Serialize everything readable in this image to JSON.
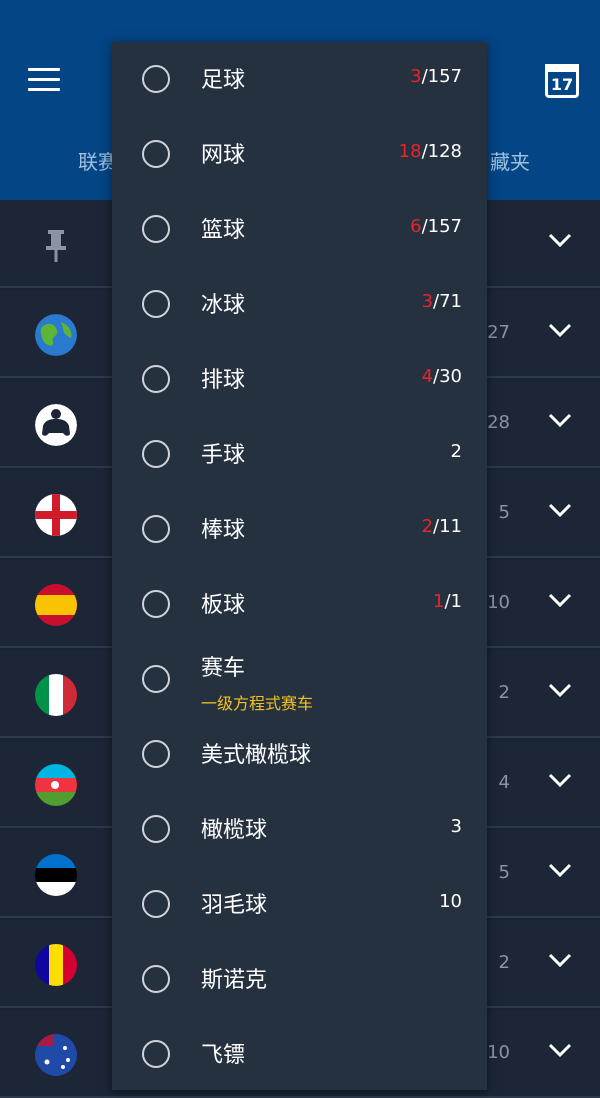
{
  "header": {
    "tab_left": "联赛",
    "tab_right": "藏夹",
    "calendar_day": "17"
  },
  "rows": [
    {
      "flag": "pin-icon",
      "count": ""
    },
    {
      "flag": "world",
      "count": "27"
    },
    {
      "flag": "esports",
      "count": "28"
    },
    {
      "flag": "england",
      "count": "5"
    },
    {
      "flag": "spain",
      "count": "10"
    },
    {
      "flag": "italy",
      "count": "2"
    },
    {
      "flag": "azerbaijan",
      "count": "4"
    },
    {
      "flag": "estonia",
      "count": "5"
    },
    {
      "flag": "andorra",
      "count": "2"
    },
    {
      "flag": "australia",
      "count": "10"
    }
  ],
  "menu": {
    "items": [
      {
        "icon": "football-icon",
        "label": "足球",
        "live": "3",
        "total": "/157"
      },
      {
        "icon": "tennis-icon",
        "label": "网球",
        "live": "18",
        "total": "/128"
      },
      {
        "icon": "basketball-icon",
        "label": "篮球",
        "live": "6",
        "total": "/157"
      },
      {
        "icon": "hockey-icon",
        "label": "冰球",
        "live": "3",
        "total": "/71"
      },
      {
        "icon": "volleyball-icon",
        "label": "排球",
        "live": "4",
        "total": "/30"
      },
      {
        "icon": "handball-icon",
        "label": "手球",
        "live": "",
        "total": "2"
      },
      {
        "icon": "baseball-icon",
        "label": "棒球",
        "live": "2",
        "total": "/11"
      },
      {
        "icon": "cricket-icon",
        "label": "板球",
        "live": "1",
        "total": "/1"
      },
      {
        "icon": "motorsport-icon",
        "label": "赛车",
        "sub": "一级方程式赛车",
        "live": "",
        "total": ""
      },
      {
        "icon": "american-football-icon",
        "label": "美式橄榄球",
        "live": "",
        "total": ""
      },
      {
        "icon": "rugby-icon",
        "label": "橄榄球",
        "live": "",
        "total": "3"
      },
      {
        "icon": "badminton-icon",
        "label": "羽毛球",
        "live": "",
        "total": "10"
      },
      {
        "icon": "snooker-icon",
        "label": "斯诺克",
        "live": "",
        "total": ""
      },
      {
        "icon": "darts-icon",
        "label": "飞镖",
        "live": "",
        "total": ""
      }
    ]
  },
  "colors": {
    "header": "#034585",
    "menu": "#263140",
    "live": "#e5252b",
    "subtitle": "#f4c21d"
  }
}
